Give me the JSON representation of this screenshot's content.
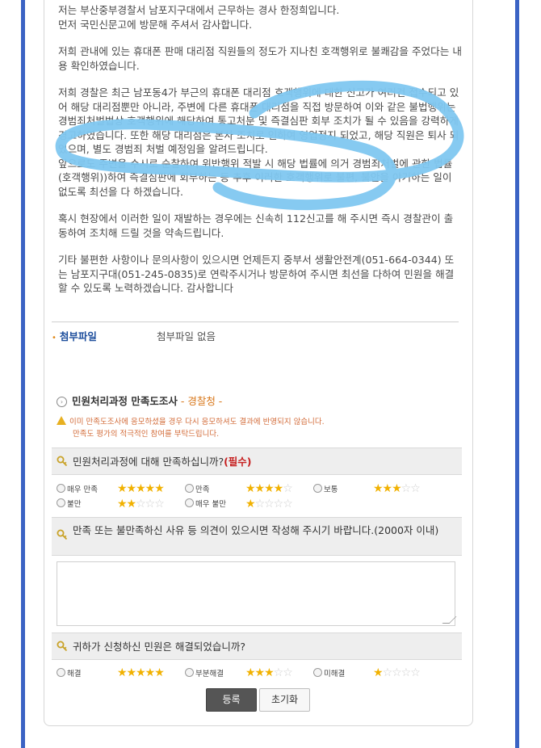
{
  "complaint_response": {
    "paragraphs": [
      "저는 부산중부경찰서 남포지구대에서 근무하는 경사 한정희입니다.\n먼저 국민신문고에 방문해 주셔서 감사합니다.",
      "저희 관내에 있는 휴대폰 판매 대리점 직원들의 정도가 지나친 호객행위로 불쾌감을 주었다는 내용 확인하였습니다.",
      "저희 경찰은 최근 남포동4가 부근의 휴대폰 대리점 호객행위에 대한 신고가 여러건 접수되고 있어 해당 대리점뿐만 아니라, 주변에 다른 휴대폰 대리점을 직접 방문하여 이와 같은 불법행위는 경범죄처벌법상 호객행위에 해당하여 통고처분 및 즉결심판 회부 조치가 될 수 있음을 강력하게 경고하였습니다. 또한 해당 대리점은 본사 조치로 인하여 영업정지 되었고, 해당 직원은 퇴사 되었으며, 별도 경범죄 처벌 예정임을 알려드립니다.\n앞으로도 주변을 수시로 순찰하여 위반행위 적발 시 해당 법률에 의거 경범죄처벌에 관한 법률(호객행위))하여 즉결심판에 회부하는 등 추후 이러한 호객행위로 불편, 불안을 야기하는 일이 없도록 최선을 다 하겠습니다.",
      "혹시 현장에서 이러한 일이 재발하는 경우에는 신속히 112신고를 해 주시면 즉시 경찰관이 출동하여 조치해 드릴 것을 약속드립니다.",
      "기타 불편한 사항이나 문의사항이 있으시면 언제든지 중부서 생활안전계(051-664-0344) 또는 남포지구대(051-245-0835)로 연락주시거나 방문하여 주시면 최선을 다하여 민원을 해결 할 수 있도록 노력하겠습니다. 감사합니다"
    ]
  },
  "attachment": {
    "label": "첨부파일",
    "value": "첨부파일 없음"
  },
  "survey": {
    "title": "민원처리과정 만족도조사",
    "org": " - 경찰청 -",
    "notice_line1": "이미 만족도조사에 응모하셨을 경우 다시 응모하셔도 결과에 반영되지 않습니다.",
    "notice_line2": "만족도 평가의 적극적인 참여를 부탁드립니다.",
    "q1": {
      "text": "민원처리과정에 대해 만족하십니까?",
      "required": "(필수)",
      "options": [
        {
          "label": "매우 만족",
          "stars": 5
        },
        {
          "label": "만족",
          "stars": 4
        },
        {
          "label": "보통",
          "stars": 3
        },
        {
          "label": "불만",
          "stars": 2
        },
        {
          "label": "매우 불만",
          "stars": 1
        }
      ]
    },
    "q2": {
      "text": "만족 또는 불만족하신 사유 등 의견이 있으시면 작성해 주시기 바랍니다.(2000자 이내)"
    },
    "q3": {
      "text": "귀하가 신청하신 민원은 해결되었습니까?",
      "options": [
        {
          "label": "해결",
          "stars": 5
        },
        {
          "label": "부분해결",
          "stars": 3
        },
        {
          "label": "미해결",
          "stars": 1
        }
      ]
    },
    "submit_label": "등록",
    "reset_label": "초기화"
  },
  "colors": {
    "frame_blue": "#3b63c4",
    "scribble_blue": "#7fc7f0",
    "star_gold": "#f1b100",
    "required_red": "#c62020",
    "org_orange": "#d8771a",
    "attach_label_blue": "#1d4e9c"
  }
}
